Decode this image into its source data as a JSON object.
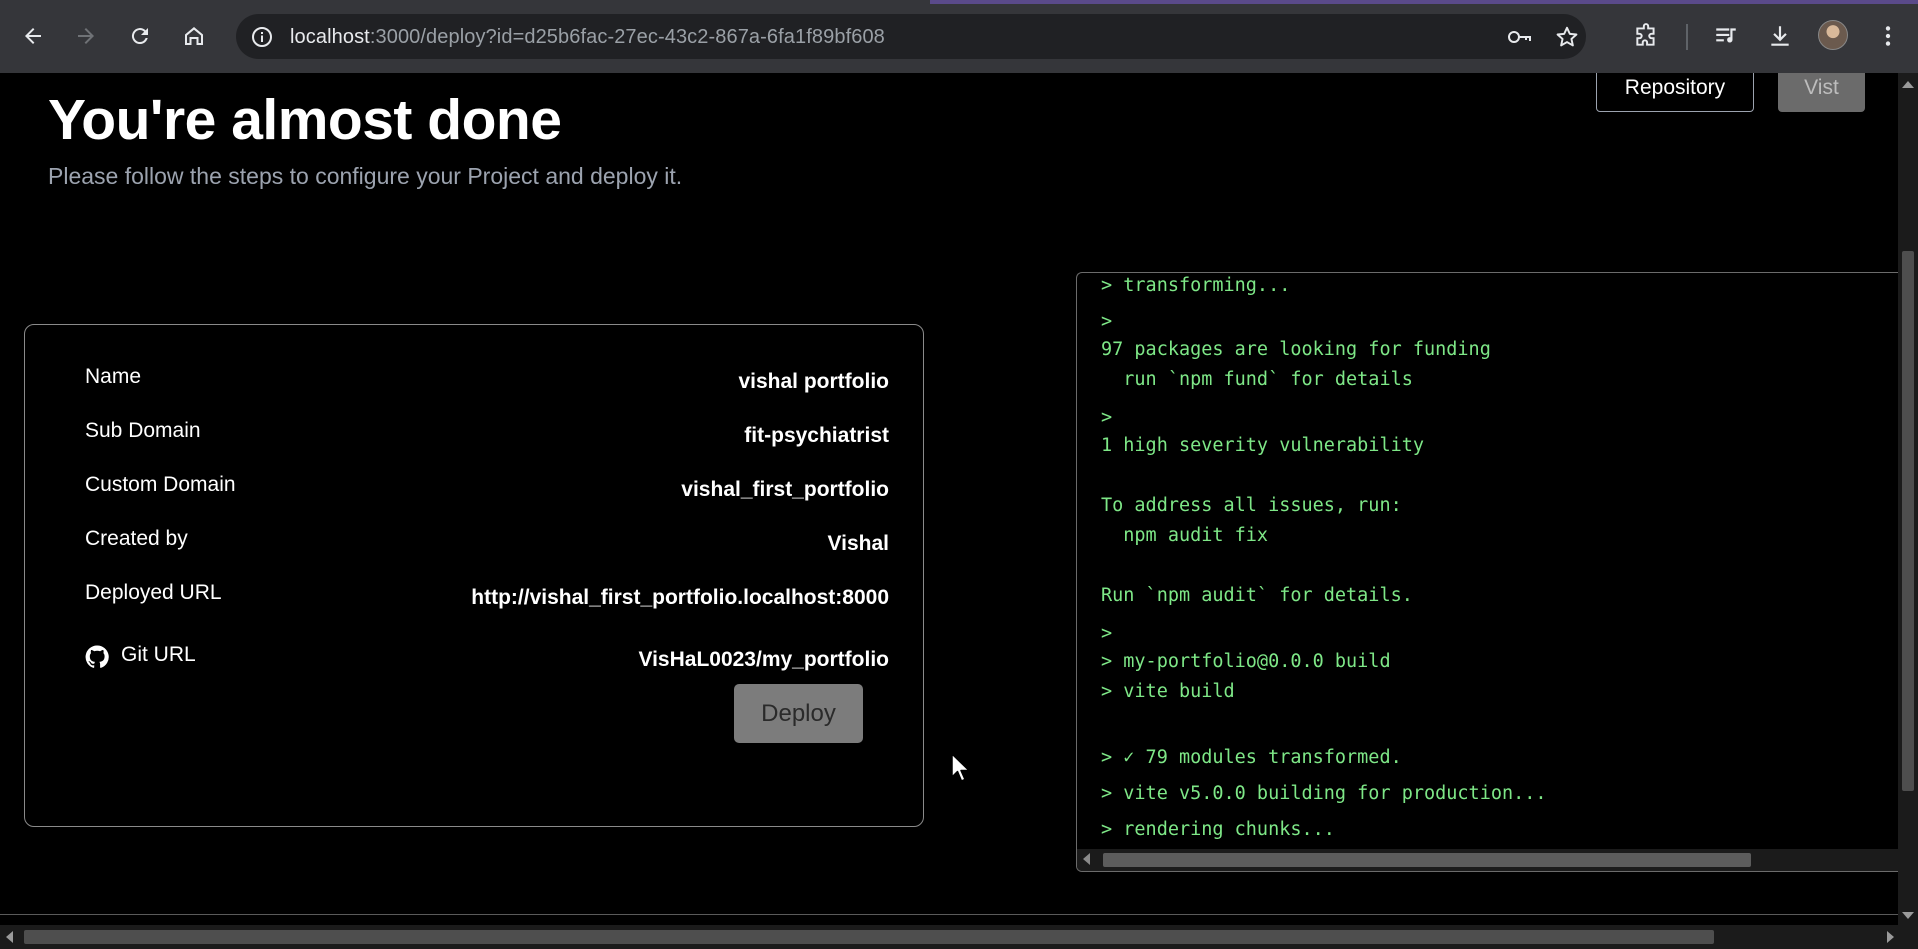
{
  "browser": {
    "url_host": "localhost",
    "url_rest": ":3000/deploy?id=d25b6fac-27ec-43c2-867a-6fa1f89bf608",
    "icons": [
      "back-icon",
      "forward-icon",
      "reload-icon",
      "home-icon",
      "site-info-icon",
      "password-key-icon",
      "bookmark-star-icon",
      "extensions-icon",
      "media-controls-icon",
      "downloads-icon",
      "profile-avatar",
      "menu-icon"
    ]
  },
  "header": {
    "title": "You're almost done",
    "subtitle": "Please follow the steps to configure your Project and deploy it.",
    "repository_label": "Repository",
    "visit_label": "Vist"
  },
  "project": {
    "rows": [
      {
        "label": "Name",
        "value": "vishal portfolio"
      },
      {
        "label": "Sub Domain",
        "value": "fit-psychiatrist"
      },
      {
        "label": "Custom Domain",
        "value": "vishal_first_portfolio"
      },
      {
        "label": "Created by",
        "value": "Vishal"
      },
      {
        "label": "Deployed URL",
        "value": "http://vishal_first_portfolio.localhost:8000"
      },
      {
        "label": "Git URL",
        "value": "VisHaL0023/my_portfolio"
      }
    ],
    "deploy_label": "Deploy"
  },
  "terminal": {
    "lines": [
      "> transforming...",
      ">",
      "97 packages are looking for funding",
      "  run `npm fund` for details",
      ">",
      "1 high severity vulnerability",
      "To address all issues, run:",
      "  npm audit fix",
      "Run `npm audit` for details.",
      ">",
      "> my-portfolio@0.0.0 build",
      "> vite build",
      "> ✓ 79 modules transformed.",
      "> vite v5.0.0 building for production...",
      "> rendering chunks..."
    ]
  },
  "colors": {
    "terminal_text": "#7ee787",
    "page_bg": "#000000",
    "chrome_bg": "#35363a"
  }
}
